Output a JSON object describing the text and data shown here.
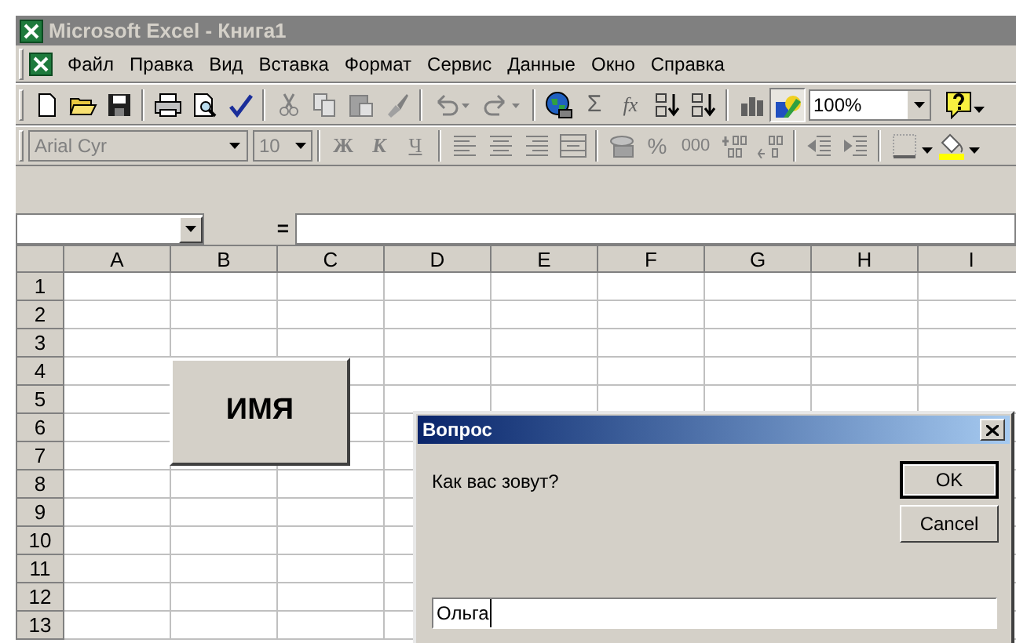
{
  "window": {
    "title": "Microsoft Excel - Книга1"
  },
  "menu": [
    {
      "label": "Файл"
    },
    {
      "label": "Правка"
    },
    {
      "label": "Вид"
    },
    {
      "label": "Вставка"
    },
    {
      "label": "Формат"
    },
    {
      "label": "Сервис"
    },
    {
      "label": "Данные"
    },
    {
      "label": "Окно"
    },
    {
      "label": "Справка"
    }
  ],
  "standard_toolbar": {
    "sum": "Σ",
    "function": "fx",
    "zoom": "100%"
  },
  "formatting_toolbar": {
    "disabled": true,
    "font": "Arial Cyr",
    "size": "10",
    "buttons": [
      {
        "label": "Ж",
        "kind": "bold"
      },
      {
        "label": "К",
        "kind": "italic"
      },
      {
        "label": "Ч",
        "kind": "underline"
      }
    ],
    "percent": "%",
    "thousands": "000"
  },
  "formula_bar": {
    "equals": "="
  },
  "sheet": {
    "columns": [
      "A",
      "B",
      "C",
      "D",
      "E",
      "F",
      "G",
      "H",
      "I"
    ],
    "rows": [
      "1",
      "2",
      "3",
      "4",
      "5",
      "6",
      "7",
      "8",
      "9",
      "10",
      "11",
      "12",
      "13"
    ]
  },
  "sheet_button": {
    "label": "ИМЯ"
  },
  "dialog": {
    "title": "Вопрос",
    "prompt": "Как вас зовут?",
    "buttons": [
      {
        "label": "OK",
        "default": true
      },
      {
        "label": "Cancel",
        "default": false
      }
    ],
    "value": "Ольга"
  }
}
